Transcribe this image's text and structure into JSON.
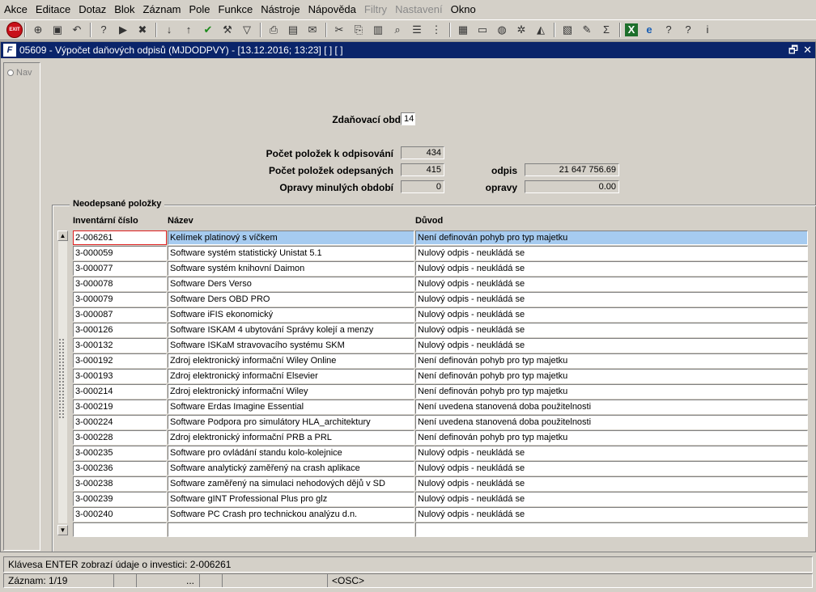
{
  "menu": [
    "Akce",
    "Editace",
    "Dotaz",
    "Blok",
    "Záznam",
    "Pole",
    "Funkce",
    "Nástroje",
    "Nápověda",
    "Filtry",
    "Nastavení",
    "Okno"
  ],
  "menu_disabled": [
    "Filtry",
    "Nastavení"
  ],
  "toolbar": {
    "exit_label": "EXIT",
    "icons": [
      "new-record-icon",
      "open-icon",
      "back-icon",
      "query-icon",
      "execute-query-icon",
      "cancel-query-icon",
      "sort-asc-icon",
      "sort-desc-icon",
      "check-icon",
      "tools-icon",
      "filter-icon",
      "print-icon",
      "print-preview-icon",
      "mail-icon",
      "cut-icon",
      "copy-icon",
      "paste-icon",
      "find-icon",
      "list-icon",
      "tree-icon",
      "clipboard-icon",
      "save-icon",
      "globe-icon",
      "settings-icon",
      "chart-icon",
      "folder-icon",
      "edit-icon",
      "sum-icon",
      "excel-icon",
      "ie-icon",
      "help-context-icon",
      "help-icon",
      "info-icon"
    ]
  },
  "window": {
    "title": "05609 - Výpočet daňových odpisů (MJDODPVY) - [13.12.2016; 13:23]  [ ]  [ ]",
    "icon_text": "F",
    "restore": "🗗",
    "close": "✕"
  },
  "nav": {
    "label": "Nav"
  },
  "form": {
    "zdanovaci_label": "Zdaňovací období",
    "zdanovaci_value": "14",
    "pocet_k_label": "Počet položek k odpisování",
    "pocet_k_value": "434",
    "pocet_od_label": "Počet položek odepsaných",
    "pocet_od_value": "415",
    "opravy_min_label": "Opravy minulých období",
    "opravy_min_value": "0",
    "odpis_label": "odpis",
    "odpis_value": "21 647 756.69",
    "opravy_label": "opravy",
    "opravy_value": "0.00"
  },
  "table": {
    "group_title": "Neodepsané položky",
    "headers": {
      "inv": "Inventární číslo",
      "name": "Název",
      "duvod": "Důvod"
    },
    "rows": [
      [
        "2-006261",
        "Kelímek platinový s víčkem",
        "Není definován pohyb pro typ majetku"
      ],
      [
        "3-000059",
        "Software systém statistický Unistat 5.1",
        "Nulový odpis - neukládá se"
      ],
      [
        "3-000077",
        "Software systém knihovní Daimon",
        "Nulový odpis - neukládá se"
      ],
      [
        "3-000078",
        "Software Ders Verso",
        "Nulový odpis - neukládá se"
      ],
      [
        "3-000079",
        "Software Ders OBD PRO",
        "Nulový odpis - neukládá se"
      ],
      [
        "3-000087",
        "Software iFIS ekonomický",
        "Nulový odpis - neukládá se"
      ],
      [
        "3-000126",
        "Software ISKAM 4 ubytování Správy kolejí a menzy",
        "Nulový odpis - neukládá se"
      ],
      [
        "3-000132",
        "Software ISKaM stravovacího systému SKM",
        "Nulový odpis - neukládá se"
      ],
      [
        "3-000192",
        "Zdroj elektronický informační Wiley Online",
        "Není definován pohyb pro typ majetku"
      ],
      [
        "3-000193",
        "Zdroj elektronický informační Elsevier",
        "Není definován pohyb pro typ majetku"
      ],
      [
        "3-000214",
        "Zdroj elektronický informační Wiley",
        "Není definován pohyb pro typ majetku"
      ],
      [
        "3-000219",
        "Software Erdas Imagine Essential",
        "Není uvedena stanovená doba použitelnosti"
      ],
      [
        "3-000224",
        "Software Podpora pro simulátory HLA_architektury",
        "Není uvedena stanovená doba použitelnosti"
      ],
      [
        "3-000228",
        "Zdroj elektronický informační PRB a PRL",
        "Není definován pohyb pro typ majetku"
      ],
      [
        "3-000235",
        "Software pro ovládání standu kolo-kolejnice",
        "Nulový odpis - neukládá se"
      ],
      [
        "3-000236",
        "Software analytický zaměřený na crash aplikace",
        "Nulový odpis - neukládá se"
      ],
      [
        "3-000238",
        "Software zaměřený na simulaci nehodových dějů v SD",
        "Nulový odpis - neukládá se"
      ],
      [
        "3-000239",
        "Software gINT Professional Plus pro glz",
        "Nulový odpis - neukládá se"
      ],
      [
        "3-000240",
        "Software PC Crash pro technickou analýzu d.n.",
        "Nulový odpis - neukládá se"
      ],
      [
        "",
        "",
        ""
      ]
    ]
  },
  "status": {
    "message": "Klávesa ENTER zobrazí údaje o investici: 2-006261",
    "record": "Záznam: 1/19",
    "seg3": "...",
    "osc": "<OSC>"
  }
}
